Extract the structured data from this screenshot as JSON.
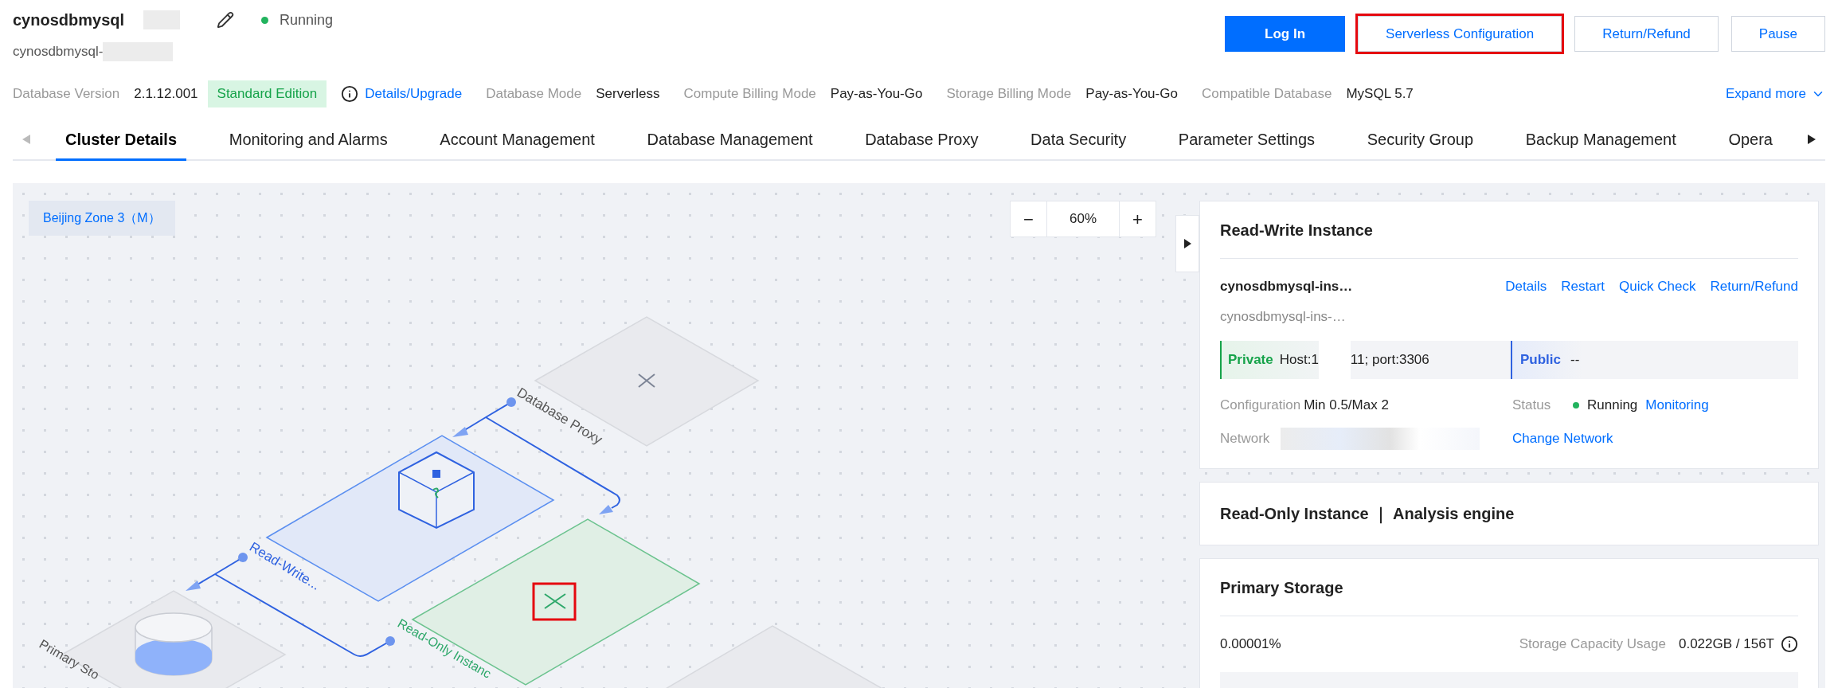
{
  "header": {
    "title": "cynosdbmysql",
    "subtitle": "cynosdbmysql-",
    "status": {
      "label": "Running",
      "color": "#22b35e"
    }
  },
  "actions": [
    {
      "label": "Log In",
      "kind": "primary",
      "highlighted": false
    },
    {
      "label": "Serverless Configuration",
      "kind": "secondary",
      "highlighted": true
    },
    {
      "label": "Return/Refund",
      "kind": "secondary",
      "highlighted": false
    },
    {
      "label": "Pause",
      "kind": "secondary",
      "highlighted": false
    }
  ],
  "info": [
    {
      "label": "Database Version",
      "value": "2.1.12.001",
      "badge": "Standard Edition",
      "link": "Details/Upgrade"
    },
    {
      "label": "Database Mode",
      "value": "Serverless"
    },
    {
      "label": "Compute Billing Mode",
      "value": "Pay-as-You-Go"
    },
    {
      "label": "Storage Billing Mode",
      "value": "Pay-as-You-Go"
    },
    {
      "label": "Compatible Database",
      "value": "MySQL 5.7"
    }
  ],
  "expand": "Expand more",
  "tabs": [
    {
      "label": "Cluster Details",
      "selected": true
    },
    {
      "label": "Monitoring and Alarms",
      "selected": false
    },
    {
      "label": "Account Management",
      "selected": false
    },
    {
      "label": "Database Management",
      "selected": false
    },
    {
      "label": "Database Proxy",
      "selected": false
    },
    {
      "label": "Data Security",
      "selected": false
    },
    {
      "label": "Parameter Settings",
      "selected": false
    },
    {
      "label": "Security Group",
      "selected": false
    },
    {
      "label": "Backup Management",
      "selected": false
    },
    {
      "label": "Opera",
      "selected": false
    }
  ],
  "canvas": {
    "zone": "Beijing Zone 3（M）",
    "zoom_out": "−",
    "zoom": "60%",
    "zoom_in": "+",
    "nodes": [
      {
        "kind": "proxy",
        "label": "Database Proxy"
      },
      {
        "kind": "read_write",
        "label": "Read-Write..."
      },
      {
        "kind": "read_only",
        "label": "Read-Only Instanc",
        "highlighted": true
      },
      {
        "kind": "storage",
        "label": "Primary Sto"
      },
      {
        "kind": "blank"
      }
    ]
  },
  "read_write_card": {
    "title": "Read-Write Instance",
    "instance_name": "cynosdbmysql-ins…",
    "instance_id": "cynosdbmysql-ins-…",
    "actions": [
      "Details",
      "Restart",
      "Quick Check",
      "Return/Refund"
    ],
    "private": {
      "label": "Private",
      "host_start": "Host:1",
      "host_end": "11; port:3306"
    },
    "public": {
      "label": "Public",
      "value": "--"
    },
    "configuration": {
      "label": "Configuration",
      "value": "Min 0.5/Max 2"
    },
    "status": {
      "label": "Status",
      "value": "Running",
      "color": "#22b35e",
      "link": "Monitoring"
    },
    "network": {
      "label": "Network",
      "link": "Change Network"
    }
  },
  "read_only_card": {
    "title": "Read-Only Instance ｜ Analysis engine"
  },
  "storage_card": {
    "title": "Primary Storage",
    "percent": "0.00001%",
    "usage_label": "Storage Capacity Usage",
    "usage_value": "0.022GB / 156T"
  }
}
